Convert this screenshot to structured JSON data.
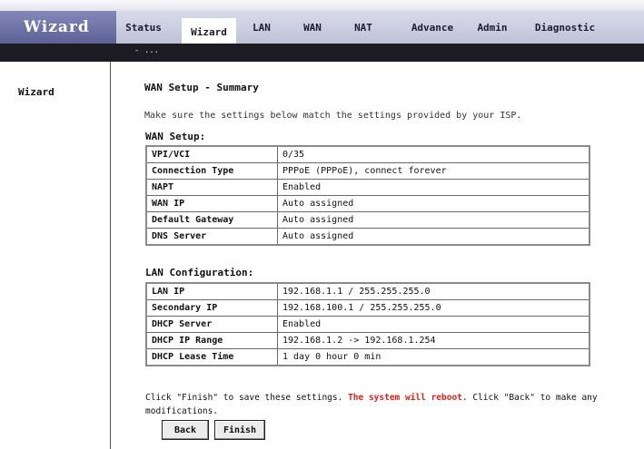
{
  "app": {
    "logo": "Wizard"
  },
  "nav": {
    "tabs": [
      {
        "label": "Status",
        "active": false
      },
      {
        "label": "Wizard",
        "active": true
      },
      {
        "label": "LAN",
        "active": false
      },
      {
        "label": "WAN",
        "active": false
      },
      {
        "label": "NAT",
        "active": false
      },
      {
        "label": "Advance",
        "active": false
      },
      {
        "label": "Admin",
        "active": false
      },
      {
        "label": "Diagnostic",
        "active": false
      }
    ],
    "subnav_item": "- ..."
  },
  "sidebar": {
    "items": [
      {
        "label": "Wizard"
      }
    ]
  },
  "main": {
    "title": "WAN Setup - Summary",
    "description": "Make sure the settings below match the settings provided by your ISP.",
    "wan": {
      "section_title": "WAN Setup:",
      "rows": [
        {
          "label": "VPI/VCI",
          "value": "0/35"
        },
        {
          "label": "Connection Type",
          "value": "PPPoE (PPPoE), connect forever"
        },
        {
          "label": "NAPT",
          "value": "Enabled"
        },
        {
          "label": "WAN IP",
          "value": "Auto assigned"
        },
        {
          "label": "Default Gateway",
          "value": "Auto assigned"
        },
        {
          "label": "DNS Server",
          "value": "Auto assigned"
        }
      ]
    },
    "lan": {
      "section_title": "LAN Configuration:",
      "rows": [
        {
          "label": "LAN IP",
          "value": "192.168.1.1 / 255.255.255.0"
        },
        {
          "label": "Secondary IP",
          "value": "192.168.100.1 / 255.255.255.0"
        },
        {
          "label": "DHCP Server",
          "value": "Enabled"
        },
        {
          "label": "DHCP IP Range",
          "value": "192.168.1.2 -> 192.168.1.254"
        },
        {
          "label": "DHCP Lease Time",
          "value": "1 day 0 hour 0 min"
        }
      ]
    },
    "note": {
      "before": "Click \"Finish\" to save these settings.",
      "warning": " The system will reboot.",
      "after": " Click \"Back\" to make any modifications."
    },
    "buttons": {
      "back": "Back",
      "finish": "Finish"
    }
  }
}
